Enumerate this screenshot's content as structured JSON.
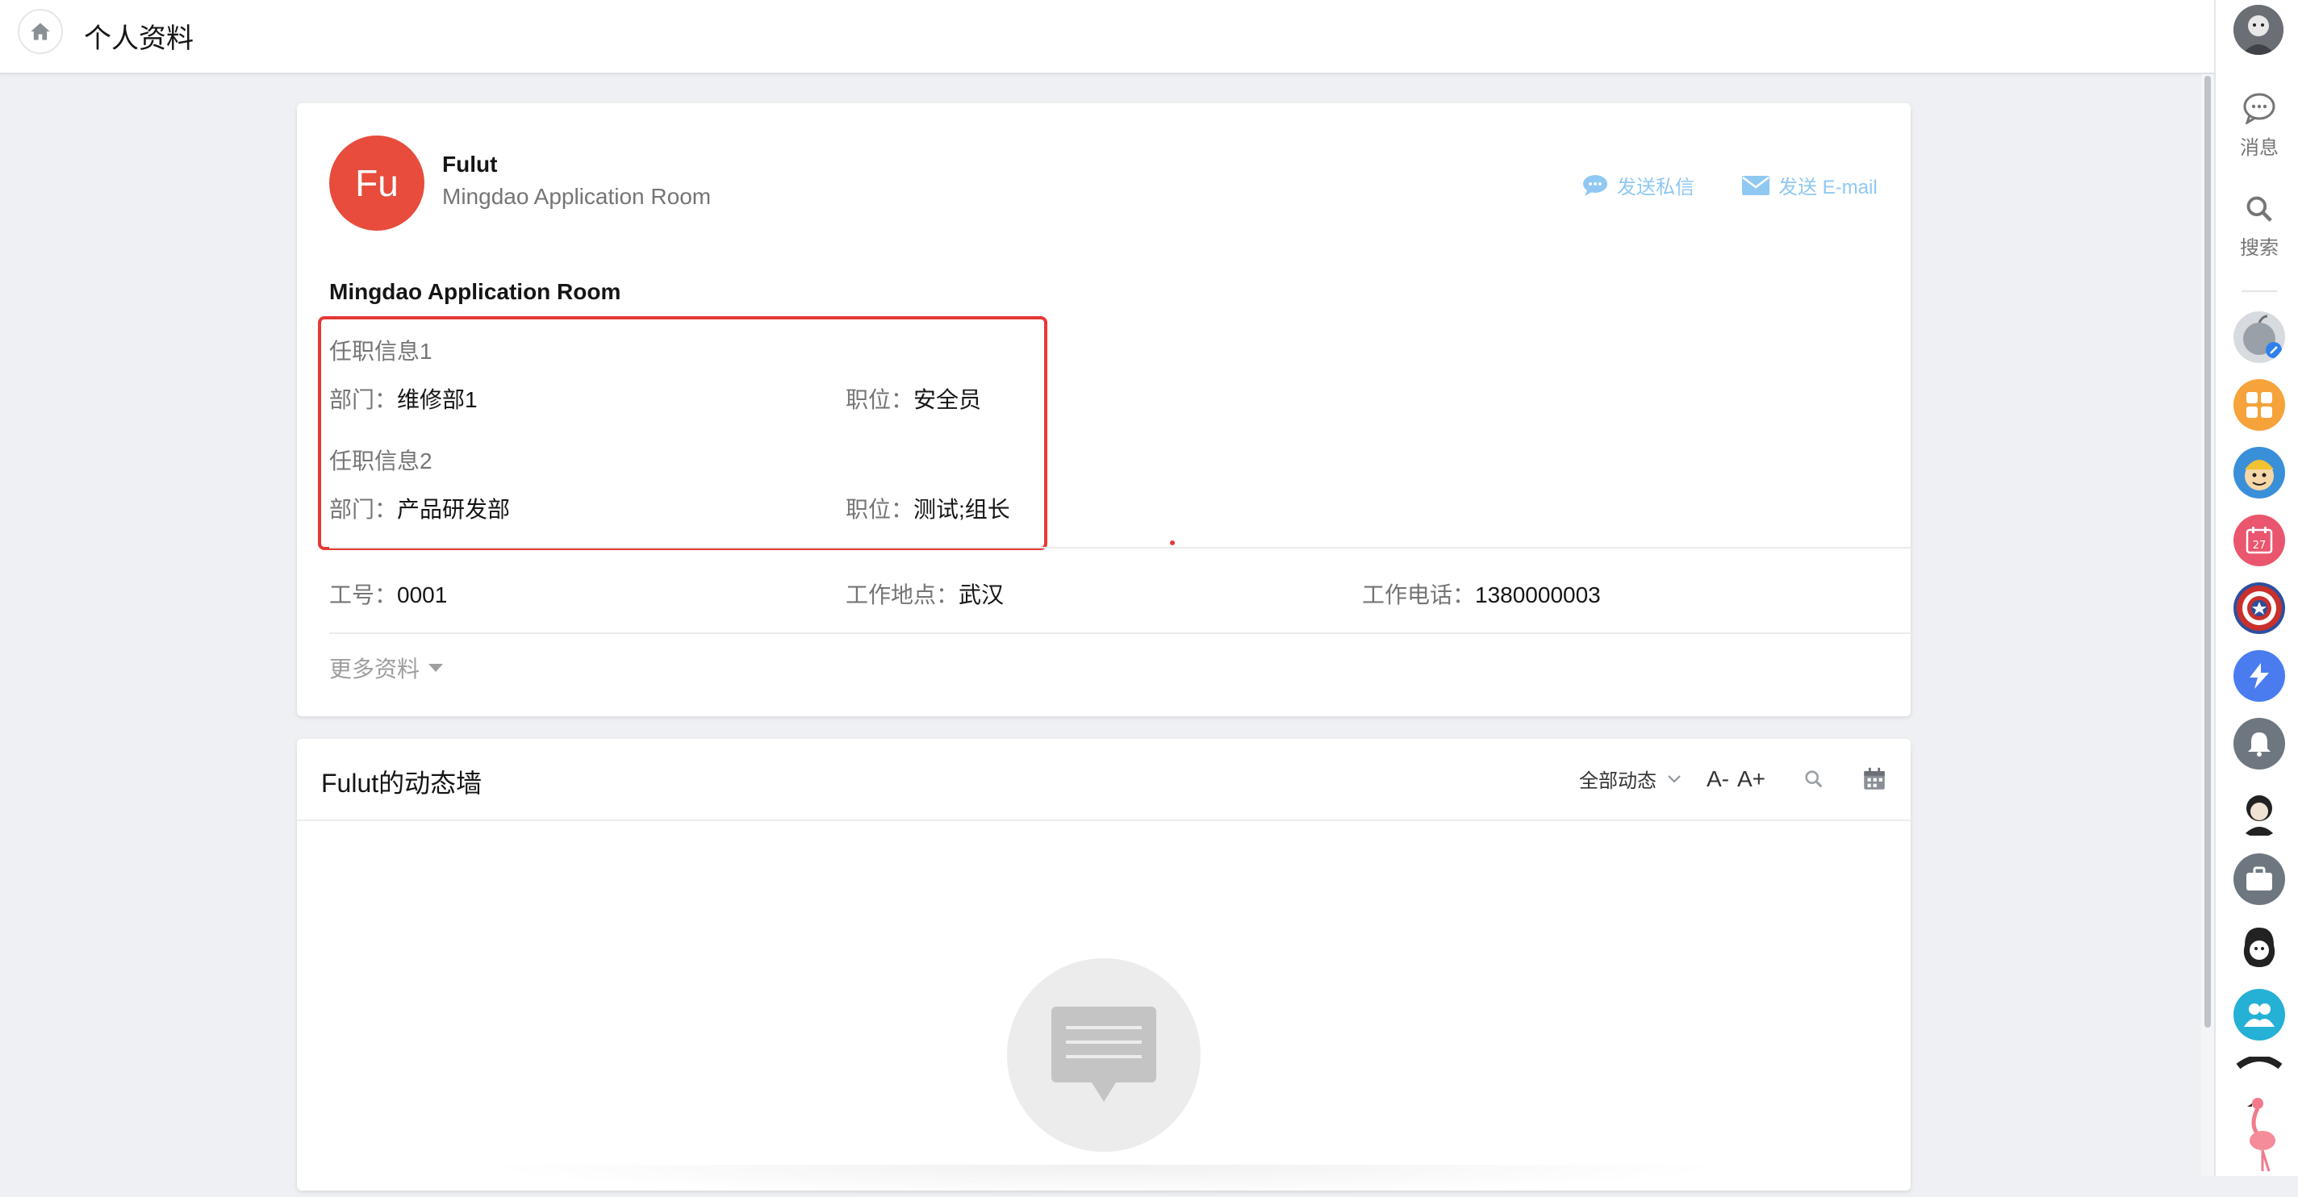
{
  "header": {
    "title": "个人资料"
  },
  "profile": {
    "avatar_initials": "Fu",
    "avatar_color": "#e74c3c",
    "name": "Fulut",
    "organization": "Mingdao Application Room",
    "actions": {
      "send_message": "发送私信",
      "send_email": "发送 E-mail"
    },
    "org_heading": "Mingdao Application Room",
    "jobs": [
      {
        "title": "任职信息1",
        "dept_label": "部门：",
        "dept_value": "维修部1",
        "position_label": "职位：",
        "position_value": "安全员"
      },
      {
        "title": "任职信息2",
        "dept_label": "部门：",
        "dept_value": "产品研发部",
        "position_label": "职位：",
        "position_value": "测试;组长"
      }
    ],
    "details": {
      "employee_no_label": "工号：",
      "employee_no": "0001",
      "location_label": "工作地点：",
      "location": "武汉",
      "phone_label": "工作电话：",
      "phone": "1380000003"
    },
    "more_info": "更多资料"
  },
  "feed": {
    "title": "Fulut的动态墙",
    "filter": "全部动态",
    "font_decrease": "A-",
    "font_increase": "A+"
  },
  "sidebar": {
    "tools": [
      {
        "label": "消息",
        "icon": "chat-bubble-icon"
      },
      {
        "label": "搜索",
        "icon": "search-icon"
      }
    ],
    "apps": [
      {
        "icon": "apple-app-icon",
        "color": "#cfd3d8"
      },
      {
        "icon": "grid-app-icon",
        "color": "#f5a33a"
      },
      {
        "icon": "vault-boy-app-icon",
        "color": "#3a8fd9"
      },
      {
        "icon": "calendar-app-icon",
        "color": "#e9566d",
        "badge": "27"
      },
      {
        "icon": "captain-shield-app-icon",
        "color": "#2d4f9e"
      },
      {
        "icon": "lightning-app-icon",
        "color": "#4a7cf0"
      },
      {
        "icon": "bell-app-icon",
        "color": "#6e7780"
      },
      {
        "icon": "person-app-icon",
        "color": "#ffffff"
      },
      {
        "icon": "briefcase-app-icon",
        "color": "#6e7780"
      },
      {
        "icon": "cartoon-app-icon",
        "color": "#ffffff"
      },
      {
        "icon": "group-app-icon",
        "color": "#25b0d6"
      },
      {
        "icon": "flamingo-app-icon",
        "color": "#ffffff"
      }
    ]
  },
  "colors": {
    "accent_link": "#8fc8f2",
    "highlight_border": "#e53935",
    "page_bg": "#eef0f3"
  }
}
